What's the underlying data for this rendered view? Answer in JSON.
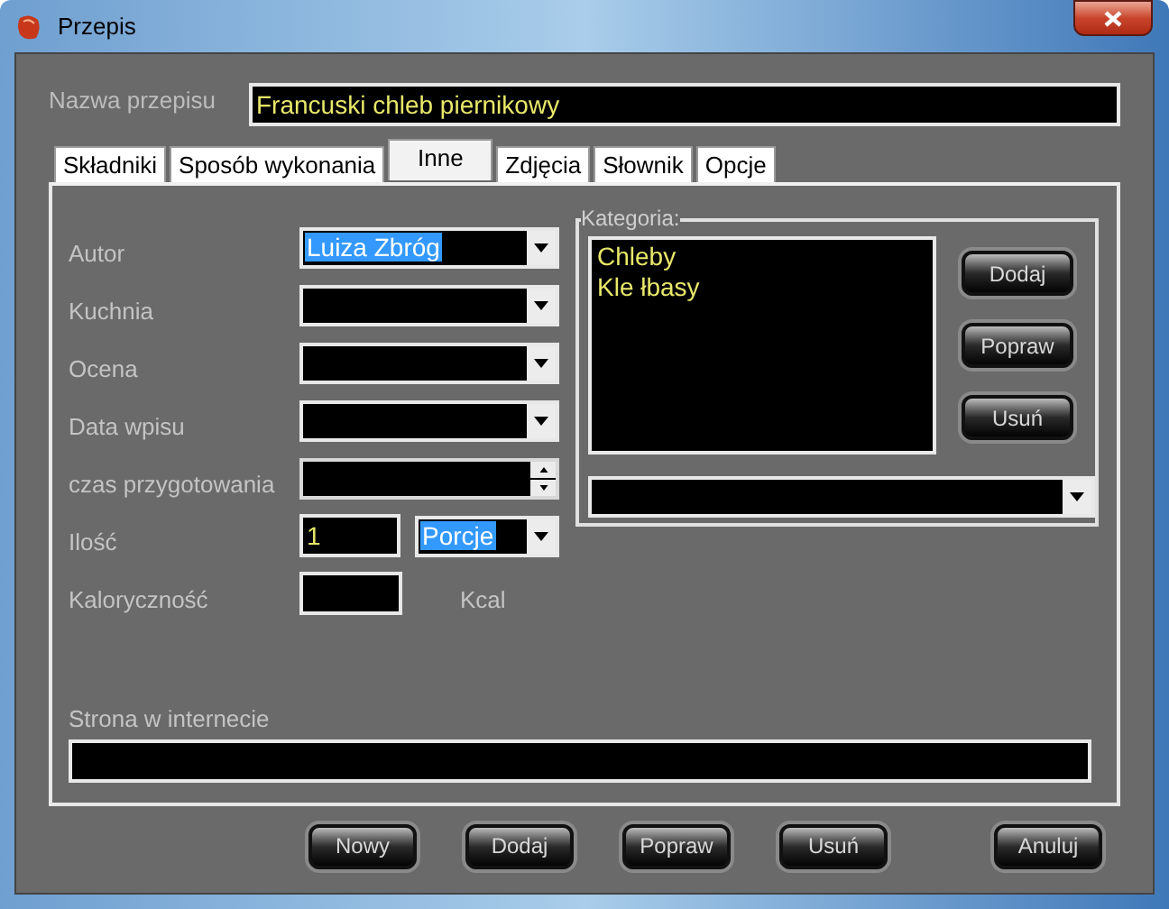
{
  "window": {
    "title": "Przepis"
  },
  "recipe_name": {
    "label": "Nazwa przepisu",
    "value": "Francuski chleb piernikowy"
  },
  "tabs": [
    {
      "label": "Składniki",
      "selected": false
    },
    {
      "label": "Sposób wykonania",
      "selected": false
    },
    {
      "label": "Inne",
      "selected": true
    },
    {
      "label": "Zdjęcia",
      "selected": false
    },
    {
      "label": "Słownik",
      "selected": false
    },
    {
      "label": "Opcje",
      "selected": false
    }
  ],
  "fields": [
    {
      "kind": "combo",
      "label": "Autor",
      "value": "Luiza Zbróg",
      "highlighted": true
    },
    {
      "kind": "combo",
      "label": "Kuchnia"
    },
    {
      "kind": "combo",
      "label": "Ocena"
    },
    {
      "kind": "combo",
      "label": "Data wpisu"
    },
    {
      "kind": "spin",
      "label": "czas przygotowania"
    },
    {
      "kind": "amount",
      "label": "Ilość",
      "value": "1",
      "unit": "Porcje",
      "highlighted": true
    },
    {
      "kind": "calories",
      "label": "Kaloryczność",
      "unit": "Kcal"
    }
  ],
  "category": {
    "label": "Kategoria:",
    "items": [
      "Chleby",
      "Kle łbasy"
    ],
    "buttons": [
      "Dodaj",
      "Popraw",
      "Usuń"
    ]
  },
  "website": {
    "label": "Strona w internecie"
  },
  "buttons": [
    "Nowy",
    "Dodaj",
    "Popraw",
    "Usuń",
    "Anuluj"
  ]
}
